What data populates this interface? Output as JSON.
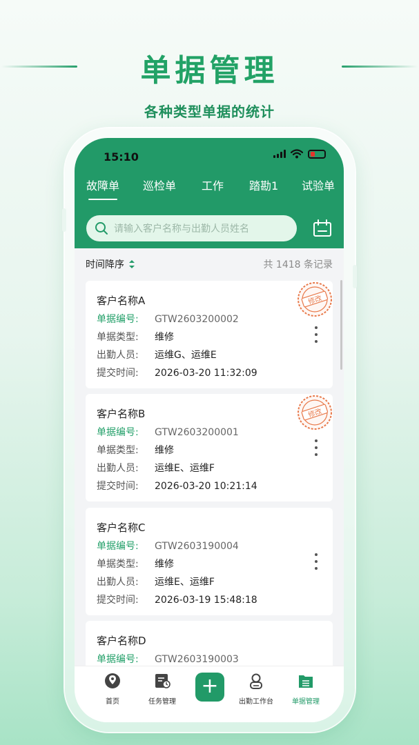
{
  "hero": {
    "title": "单据管理",
    "subtitle": "各种类型单据的统计"
  },
  "status_bar": {
    "time": "15:10"
  },
  "tabs": [
    {
      "label": "故障单",
      "active": true
    },
    {
      "label": "巡检单"
    },
    {
      "label": "工作"
    },
    {
      "label": "踏勘1"
    },
    {
      "label": "试验单"
    }
  ],
  "search": {
    "placeholder": "请输入客户名称与出勤人员姓名"
  },
  "toolbar": {
    "sort_label": "时间降序",
    "record_count": "共 1418 条记录"
  },
  "field_labels": {
    "number": "单据编号:",
    "type": "单据类型:",
    "staff": "出勤人员:",
    "time": "提交时间:"
  },
  "cards": [
    {
      "customer": "客户名称A",
      "number": "GTW2603200002",
      "type": "维修",
      "staff": "运维G、运维E",
      "time": "2026-03-20 11:32:09",
      "stamp": "修改"
    },
    {
      "customer": "客户名称B",
      "number": "GTW2603200001",
      "type": "维修",
      "staff": "运维E、运维F",
      "time": "2026-03-20 10:21:14",
      "stamp": "修改"
    },
    {
      "customer": "客户名称C",
      "number": "GTW2603190004",
      "type": "维修",
      "staff": "运维E、运维F",
      "time": "2026-03-19 15:48:18"
    },
    {
      "customer": "客户名称D",
      "number": "GTW2603190003"
    }
  ],
  "bottom_nav": [
    {
      "label": "首页",
      "icon": "home-map-icon"
    },
    {
      "label": "任务管理",
      "icon": "task-icon"
    },
    {
      "label": "+",
      "icon": "add-icon"
    },
    {
      "label": "出勤工作台",
      "icon": "person-icon"
    },
    {
      "label": "单据管理",
      "icon": "document-icon",
      "active": true
    }
  ],
  "colors": {
    "primary": "#229a68",
    "stamp": "#e8794a",
    "search_bg": "#e3f6ea"
  }
}
